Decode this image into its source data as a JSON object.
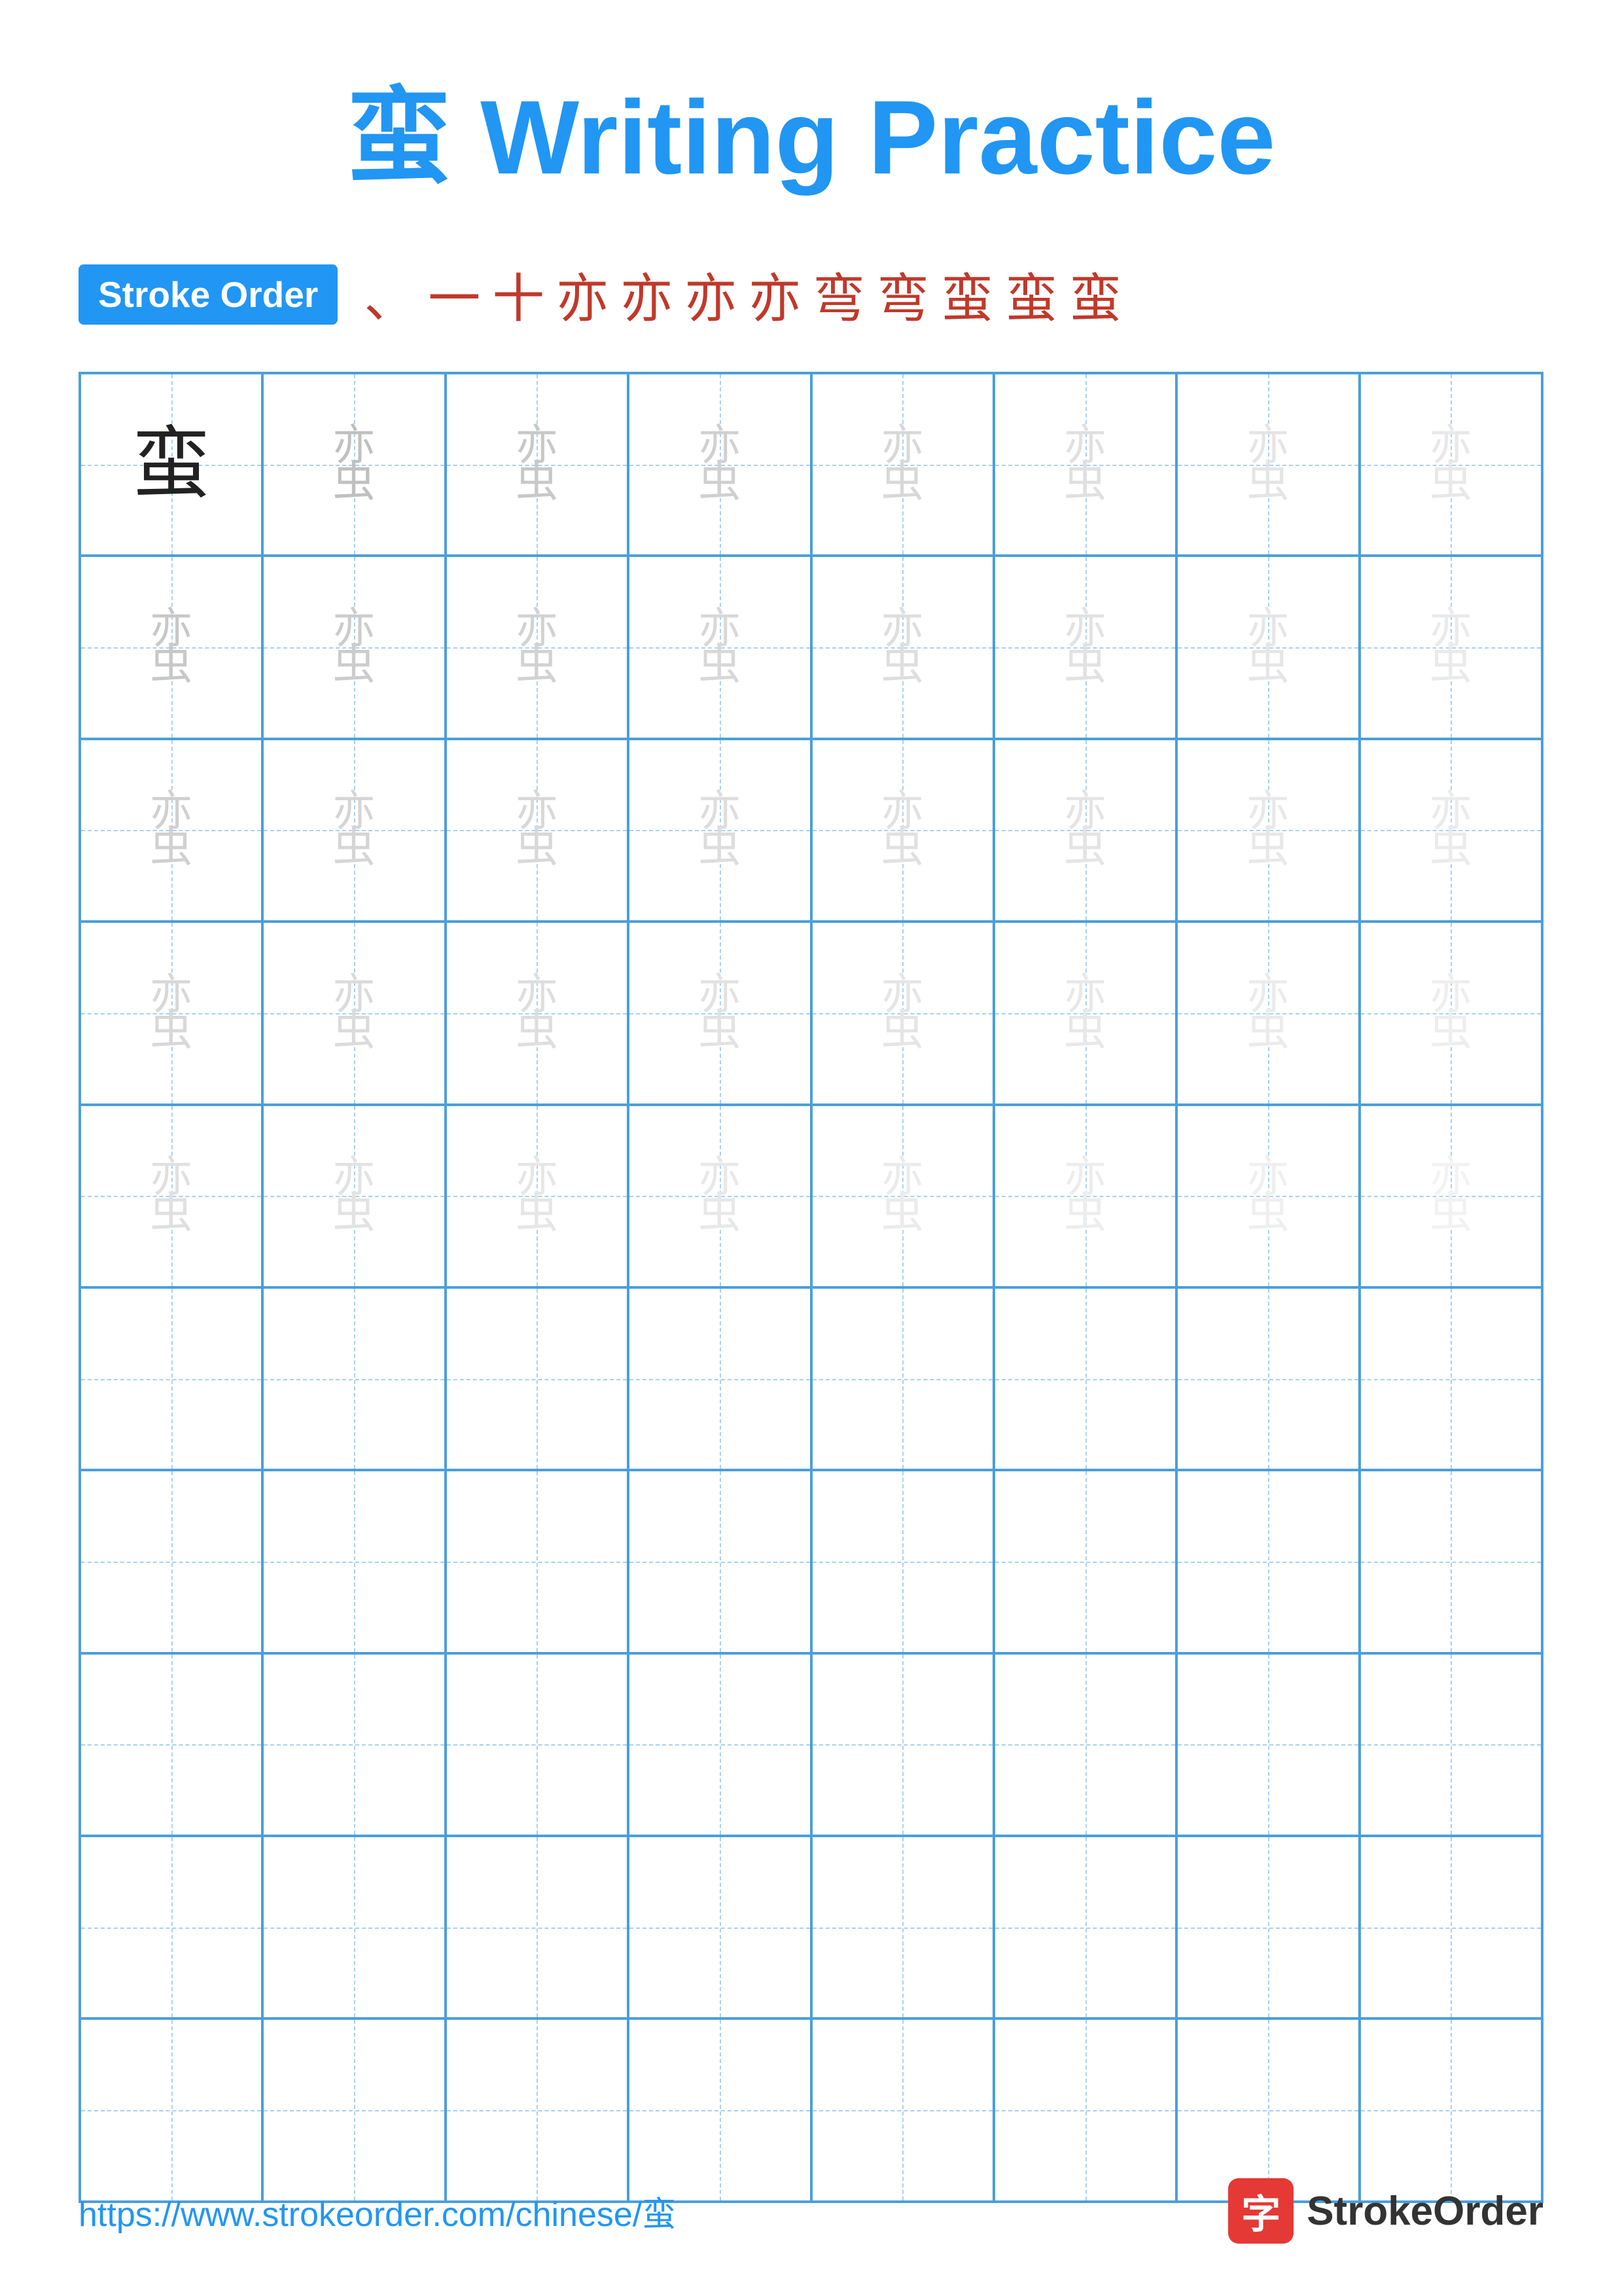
{
  "page": {
    "title": "蛮 Writing Practice",
    "title_char": "蛮",
    "title_text": " Writing Practice"
  },
  "stroke_order": {
    "badge_label": "Stroke Order",
    "strokes": [
      "、",
      "一",
      "十",
      "亦",
      "亦",
      "亦",
      "亦",
      "弯",
      "弯",
      "蛮",
      "蛮",
      "蛮"
    ]
  },
  "grid": {
    "cols": 8,
    "practice_rows": 5,
    "empty_rows": 5,
    "char": "蛮",
    "char_top": "亦",
    "char_bottom": "虫"
  },
  "footer": {
    "url": "https://www.strokeorder.com/chinese/蛮",
    "brand": "StrokeOrder",
    "logo_char": "字"
  }
}
